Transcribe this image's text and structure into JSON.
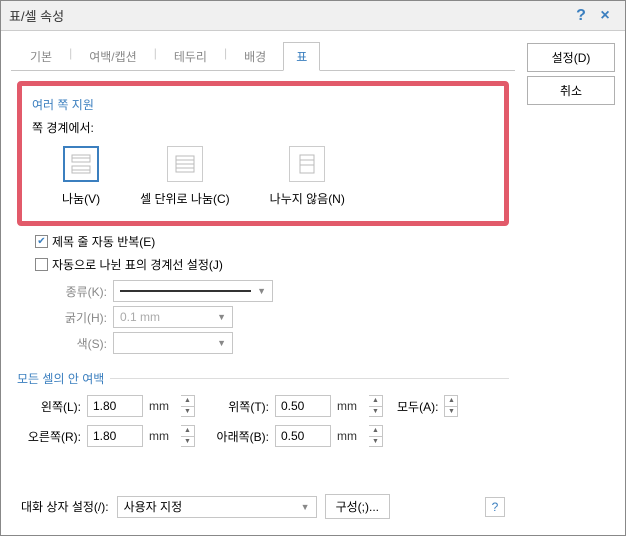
{
  "title": "표/셀 속성",
  "tabs": [
    "기본",
    "여백/캡션",
    "테두리",
    "배경",
    "표"
  ],
  "active_tab": 4,
  "side_buttons": {
    "set": "설정(D)",
    "cancel": "취소"
  },
  "page_split": {
    "title": "여러 쪽 지원",
    "boundary_label": "쪽 경계에서:",
    "options": [
      {
        "label": "나눔(V)",
        "selected": true
      },
      {
        "label": "셀 단위로 나눔(C)",
        "selected": false
      },
      {
        "label": "나누지 않음(N)",
        "selected": false
      }
    ],
    "repeat_header": {
      "label": "제목 줄 자동 반복(E)",
      "checked": true
    },
    "auto_border": {
      "label": "자동으로 나뉜 표의 경계선 설정(J)",
      "checked": false
    },
    "type_label": "종류(K):",
    "thickness_label": "굵기(H):",
    "thickness_value": "0.1 mm",
    "color_label": "색(S):"
  },
  "cell_margin": {
    "title": "모든 셀의 안 여백",
    "left_label": "왼쪽(L):",
    "left_value": "1.80",
    "right_label": "오른쪽(R):",
    "right_value": "1.80",
    "top_label": "위쪽(T):",
    "top_value": "0.50",
    "bottom_label": "아래쪽(B):",
    "bottom_value": "0.50",
    "unit": "mm",
    "all_label": "모두(A):"
  },
  "footer": {
    "dlg_label": "대화 상자 설정(/):",
    "dlg_value": "사용자 지정",
    "compose": "구성(;)..."
  }
}
